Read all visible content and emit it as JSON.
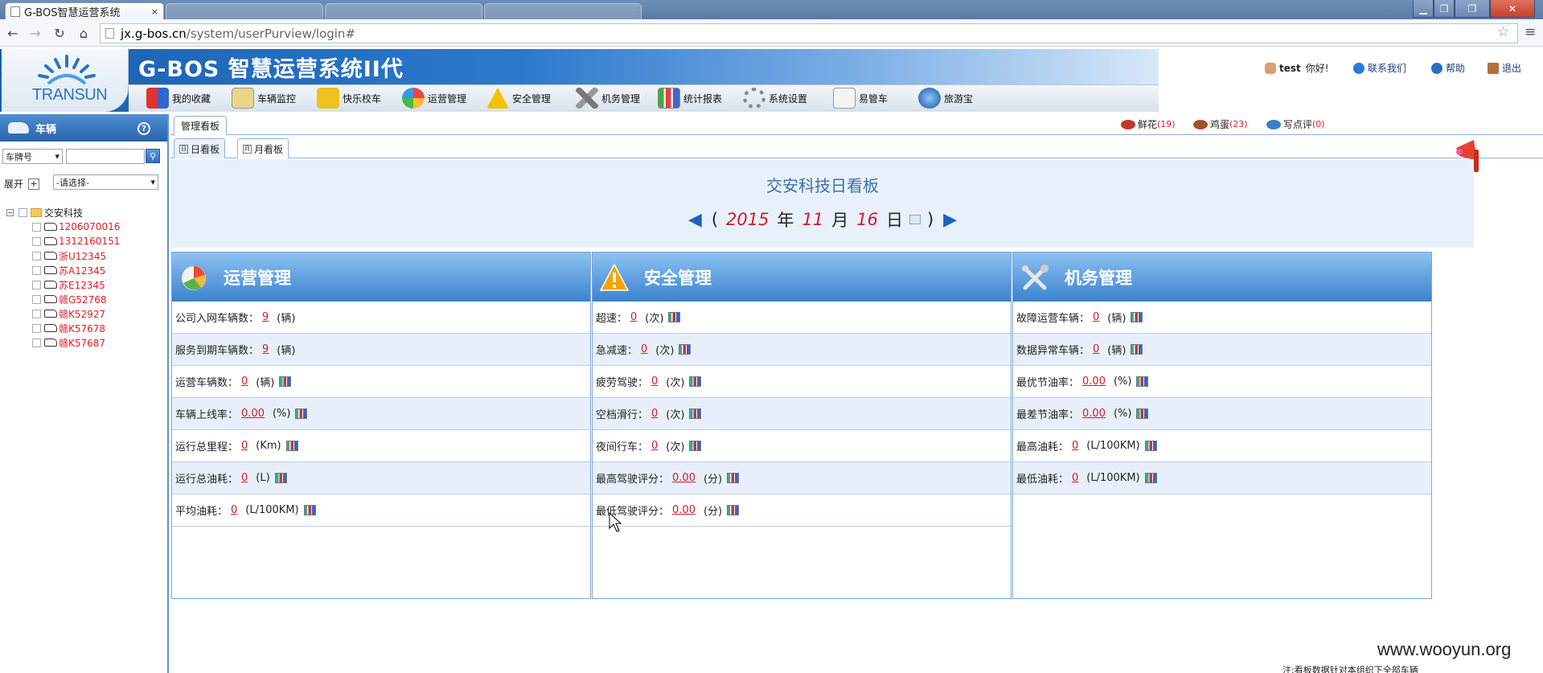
{
  "browser": {
    "tab_title": "G-BOS智慧运营系统",
    "tab_close": "×",
    "url_host": "jx.g-bos.cn",
    "url_path": "/system/userPurview/login#",
    "win_min": "▁",
    "win_max": "❐",
    "win_close": "✕",
    "back": "←",
    "forward": "→",
    "reload": "↻",
    "home": "⌂",
    "star": "☆",
    "menu": "≡"
  },
  "header": {
    "logo_text": "TRANSUN",
    "app_title": "G-BOS 智慧运营系统II代",
    "menu": [
      {
        "label": "我的收藏",
        "icon": "favorites-icon"
      },
      {
        "label": "车辆监控",
        "icon": "vehicle-monitor-icon"
      },
      {
        "label": "快乐校车",
        "icon": "school-bus-icon"
      },
      {
        "label": "运营管理",
        "icon": "operations-icon"
      },
      {
        "label": "安全管理",
        "icon": "warning-icon"
      },
      {
        "label": "机务管理",
        "icon": "tools-icon"
      },
      {
        "label": "统计报表",
        "icon": "report-icon"
      },
      {
        "label": "系统设置",
        "icon": "settings-icon"
      },
      {
        "label": "易管车",
        "icon": "easy-car-icon"
      },
      {
        "label": "旅游宝",
        "icon": "travel-icon"
      }
    ],
    "user_name": "test",
    "greeting": "你好!",
    "contact": "联系我们",
    "help": "帮助",
    "logout": "退出"
  },
  "sidebar": {
    "title": "车辆",
    "help_glyph": "?",
    "search_type": "车牌号",
    "search_value": "",
    "expand_label": "展开",
    "expand_glyph": "+",
    "group_select": "-请选择-",
    "tree_root": "交安科技",
    "vehicles": [
      "1206070016",
      "1312160151",
      "浙U12345",
      "苏A12345",
      "苏E12345",
      "赣G52768",
      "赣K52927",
      "赣K57678",
      "赣K57687"
    ]
  },
  "main": {
    "tab": "管理看板",
    "stats": [
      {
        "label": "鲜花",
        "count": "(19)",
        "color": "#c0392b"
      },
      {
        "label": "鸡蛋",
        "count": "(23)",
        "color": "#a0522d"
      },
      {
        "label": "写点评",
        "count": "(0)",
        "color": "#3d7fc4"
      }
    ],
    "subtabs": [
      {
        "label": "日看板",
        "glyph": "日"
      },
      {
        "label": "月看板",
        "glyph": "月"
      }
    ],
    "dash_title": "交安科技日看板",
    "date": {
      "prev": "◀",
      "lparen": "(",
      "year": "2015",
      "year_unit": "年",
      "month": "11",
      "month_unit": "月",
      "day": "16",
      "day_unit": "日",
      "rparen": ")",
      "next": "▶"
    },
    "panels": [
      {
        "title": "运营管理",
        "rows": [
          {
            "label": "公司入网车辆数：",
            "value": "9",
            "unit": "(辆)",
            "chart": false
          },
          {
            "label": "服务到期车辆数：",
            "value": "9",
            "unit": "(辆)",
            "chart": false
          },
          {
            "label": "运营车辆数：",
            "value": "0",
            "unit": "(辆)",
            "chart": true
          },
          {
            "label": "车辆上线率：",
            "value": "0.00",
            "unit": "(%)",
            "chart": true
          },
          {
            "label": "运行总里程：",
            "value": "0",
            "unit": "(Km)",
            "chart": true
          },
          {
            "label": "运行总油耗：",
            "value": "0",
            "unit": "(L)",
            "chart": true
          },
          {
            "label": "平均油耗：",
            "value": "0",
            "unit": "(L/100KM)",
            "chart": true
          }
        ]
      },
      {
        "title": "安全管理",
        "rows": [
          {
            "label": "超速：",
            "value": "0",
            "unit": "(次)",
            "chart": true
          },
          {
            "label": "急减速：",
            "value": "0",
            "unit": "(次)",
            "chart": true
          },
          {
            "label": "疲劳驾驶：",
            "value": "0",
            "unit": "(次)",
            "chart": true
          },
          {
            "label": "空档滑行：",
            "value": "0",
            "unit": "(次)",
            "chart": true
          },
          {
            "label": "夜间行车：",
            "value": "0",
            "unit": "(次)",
            "chart": true
          },
          {
            "label": "最高驾驶评分：",
            "value": "0.00",
            "unit": "(分)",
            "chart": true
          },
          {
            "label": "最低驾驶评分：",
            "value": "0.00",
            "unit": "(分)",
            "chart": true
          }
        ]
      },
      {
        "title": "机务管理",
        "rows": [
          {
            "label": "故障运营车辆：",
            "value": "0",
            "unit": "(辆)",
            "chart": true
          },
          {
            "label": "数据异常车辆：",
            "value": "0",
            "unit": "(辆)",
            "chart": true
          },
          {
            "label": "最优节油率：",
            "value": "0.00",
            "unit": "(%)",
            "chart": true
          },
          {
            "label": "最差节油率：",
            "value": "0.00",
            "unit": "(%)",
            "chart": true
          },
          {
            "label": "最高油耗：",
            "value": "0",
            "unit": "(L/100KM)",
            "chart": true
          },
          {
            "label": "最低油耗：",
            "value": "0",
            "unit": "(L/100KM)",
            "chart": true
          }
        ]
      }
    ],
    "footnote": "注:看板数据针对本组织下全部车辆"
  },
  "watermark": "www.wooyun.org",
  "colors": {
    "accent": "#2c79cc",
    "value_red": "#d11b2b",
    "panel_header": "#3b82cf",
    "row_alt": "#e8effb"
  }
}
